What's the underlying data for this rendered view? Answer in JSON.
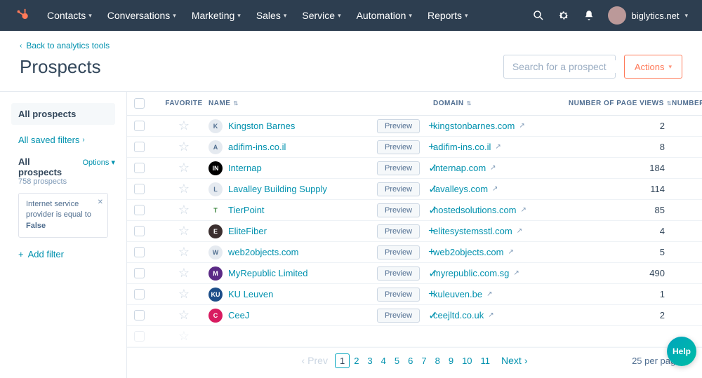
{
  "nav": {
    "items": [
      "Contacts",
      "Conversations",
      "Marketing",
      "Sales",
      "Service",
      "Automation",
      "Reports"
    ],
    "account": "biglytics.net"
  },
  "header": {
    "breadcrumb": "Back to analytics tools",
    "title": "Prospects",
    "search_placeholder": "Search for a prospect",
    "actions_label": "Actions"
  },
  "sidebar": {
    "active_tab": "All prospects",
    "saved_filters": "All saved filters",
    "section_title": "All prospects",
    "count_label": "758 prospects",
    "options_label": "Options",
    "filter": {
      "line1": "Internet service",
      "line2": "provider is equal to",
      "line3": "False"
    },
    "add_filter": "Add filter"
  },
  "table": {
    "columns": {
      "favorite": "FAVORITE",
      "name": "NAME",
      "domain": "DOMAIN",
      "page_views": "NUMBER OF PAGE VIEWS",
      "number_of": "NUMBER OF"
    },
    "preview_label": "Preview",
    "rows": [
      {
        "name": "Kingston Barnes",
        "domain": "kingstonbarnes.com",
        "views": "2",
        "added": false,
        "logo_bg": "#e5eaf0",
        "logo_fg": "#516f90",
        "logo_txt": "K"
      },
      {
        "name": "adifim-ins.co.il",
        "domain": "adifim-ins.co.il",
        "views": "8",
        "added": false,
        "logo_bg": "#e5eaf0",
        "logo_fg": "#516f90",
        "logo_txt": "A"
      },
      {
        "name": "Internap",
        "domain": "internap.com",
        "views": "184",
        "added": true,
        "logo_bg": "#000000",
        "logo_fg": "#ffffff",
        "logo_txt": "IN"
      },
      {
        "name": "Lavalley Building Supply",
        "domain": "lavalleys.com",
        "views": "114",
        "added": true,
        "logo_bg": "#e5eaf0",
        "logo_fg": "#516f90",
        "logo_txt": "L"
      },
      {
        "name": "TierPoint",
        "domain": "hostedsolutions.com",
        "views": "85",
        "added": true,
        "logo_bg": "#ffffff",
        "logo_fg": "#2e7d32",
        "logo_txt": "T"
      },
      {
        "name": "EliteFiber",
        "domain": "elitesystemsstl.com",
        "views": "4",
        "added": false,
        "logo_bg": "#3b2f2f",
        "logo_fg": "#ffffff",
        "logo_txt": "E"
      },
      {
        "name": "web2objects.com",
        "domain": "web2objects.com",
        "views": "5",
        "added": false,
        "logo_bg": "#e5eaf0",
        "logo_fg": "#516f90",
        "logo_txt": "W"
      },
      {
        "name": "MyRepublic Limited",
        "domain": "myrepublic.com.sg",
        "views": "490",
        "added": true,
        "logo_bg": "#5b2a86",
        "logo_fg": "#ffffff",
        "logo_txt": "M"
      },
      {
        "name": "KU Leuven",
        "domain": "kuleuven.be",
        "views": "1",
        "added": false,
        "logo_bg": "#1d4e89",
        "logo_fg": "#ffffff",
        "logo_txt": "KU"
      },
      {
        "name": "CeeJ",
        "domain": "ceejltd.co.uk",
        "views": "2",
        "added": true,
        "logo_bg": "#d81b60",
        "logo_fg": "#ffffff",
        "logo_txt": "C"
      }
    ]
  },
  "pagination": {
    "prev": "Prev",
    "next": "Next",
    "pages": [
      "1",
      "2",
      "3",
      "4",
      "5",
      "6",
      "7",
      "8",
      "9",
      "10",
      "11"
    ],
    "current": "1",
    "per_page": "25 per page"
  },
  "help": "Help"
}
